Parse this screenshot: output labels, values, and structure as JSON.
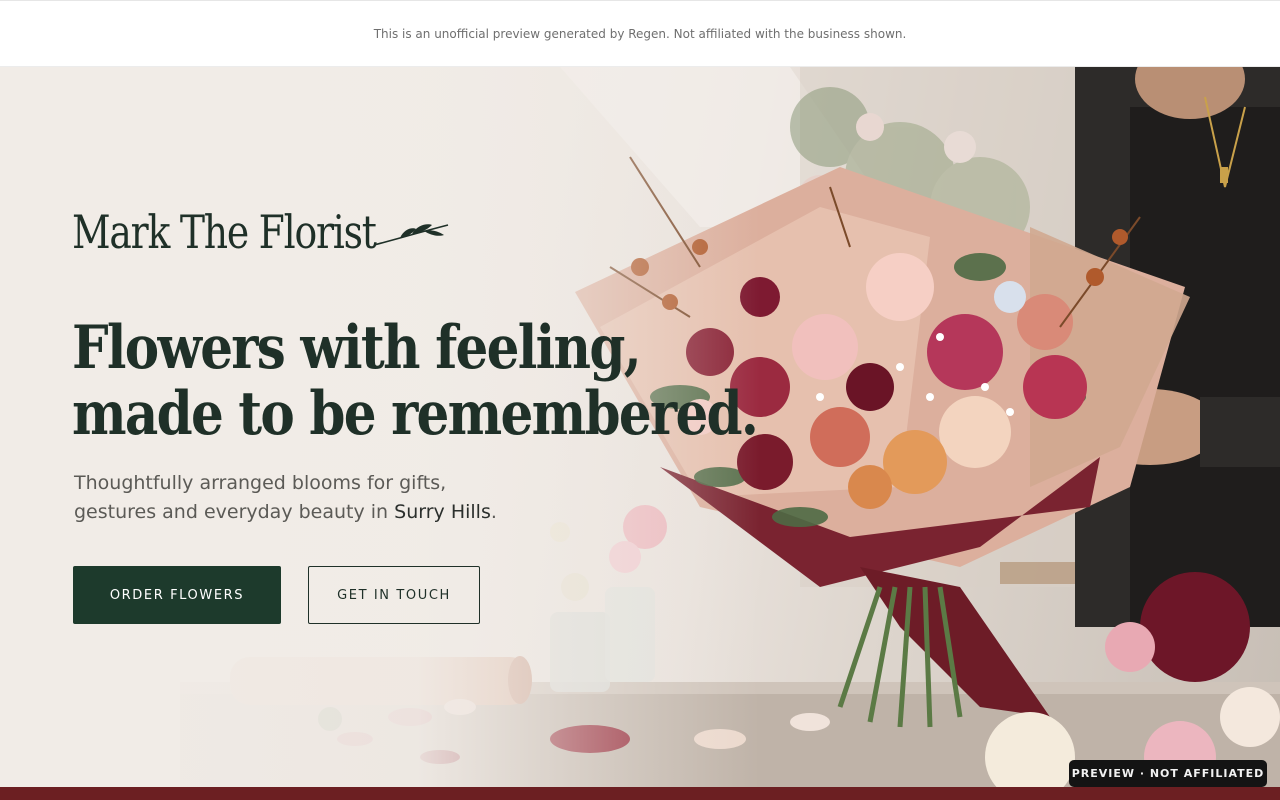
{
  "disclaimer": "This is an unofficial preview generated by Regen. Not affiliated with the business shown.",
  "brand": {
    "name": "Mark The Florist",
    "icon": "sprig-icon"
  },
  "hero": {
    "headline_line1": "Flowers with feeling,",
    "headline_line2": "made to be remembered.",
    "subtitle_part1": "Thoughtfully arranged blooms for gifts,",
    "subtitle_part2": "gestures and everyday beauty in ",
    "location": "Surry Hills",
    "subtitle_end": ".",
    "primary_button": "ORDER FLOWERS",
    "secondary_button": "GET IN TOUCH",
    "photo": "florist-bouquet-image"
  },
  "badge": "PREVIEW · NOT AFFILIATED",
  "colors": {
    "primary_green": "#1d3a2c",
    "text_dark": "#1f3028",
    "accent_burgundy": "#6c1f22",
    "background": "#f0ebe6"
  }
}
